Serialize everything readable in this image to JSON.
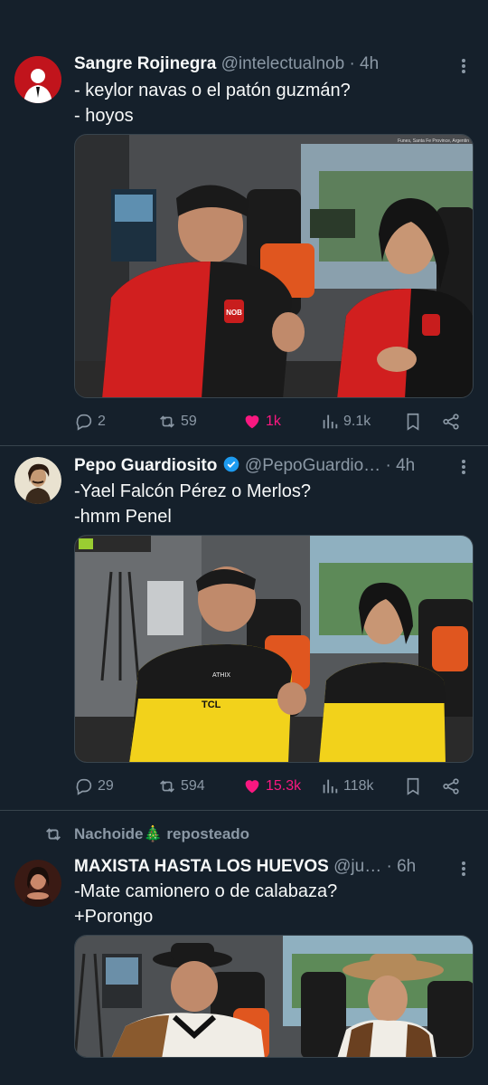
{
  "tweets": [
    {
      "name": "Sangre Rojinegra",
      "handle": "@intelectualnob",
      "time": "4h",
      "lines": [
        "- keylor navas o el patón guzmán?",
        "- hoyos"
      ],
      "replies": "2",
      "reposts": "59",
      "likes": "1k",
      "views": "9.1k",
      "media_caption": "Funes, Santa Fe Province, Argentin",
      "jersey_badge": "NOB"
    },
    {
      "name": "Pepo Guardiosito",
      "handle": "@PepoGuardio…",
      "time": "4h",
      "lines": [
        "-Yael Falcón Pérez o Merlos?",
        "-hmm Penel"
      ],
      "replies": "29",
      "reposts": "594",
      "likes": "15.3k",
      "views": "118k",
      "jersey_sponsor": "TCL",
      "jersey_brand": "ATHIX"
    },
    {
      "repost_label": "Nachoide🎄 reposteado",
      "name": "MAXISTA HASTA LOS HUEVOS",
      "handle": "@ju…",
      "time": "6h",
      "lines": [
        "-Mate camionero o de calabaza?",
        "+Porongo"
      ]
    }
  ],
  "colors": {
    "background": "#15202b",
    "separator": "#38444d",
    "muted": "#8b98a5",
    "like": "#f91880",
    "verified": "#1d9bf0"
  },
  "icons": [
    "reply-icon",
    "repost-icon",
    "like-icon",
    "views-icon",
    "bookmark-icon",
    "share-icon",
    "more-icon",
    "verified-icon"
  ]
}
